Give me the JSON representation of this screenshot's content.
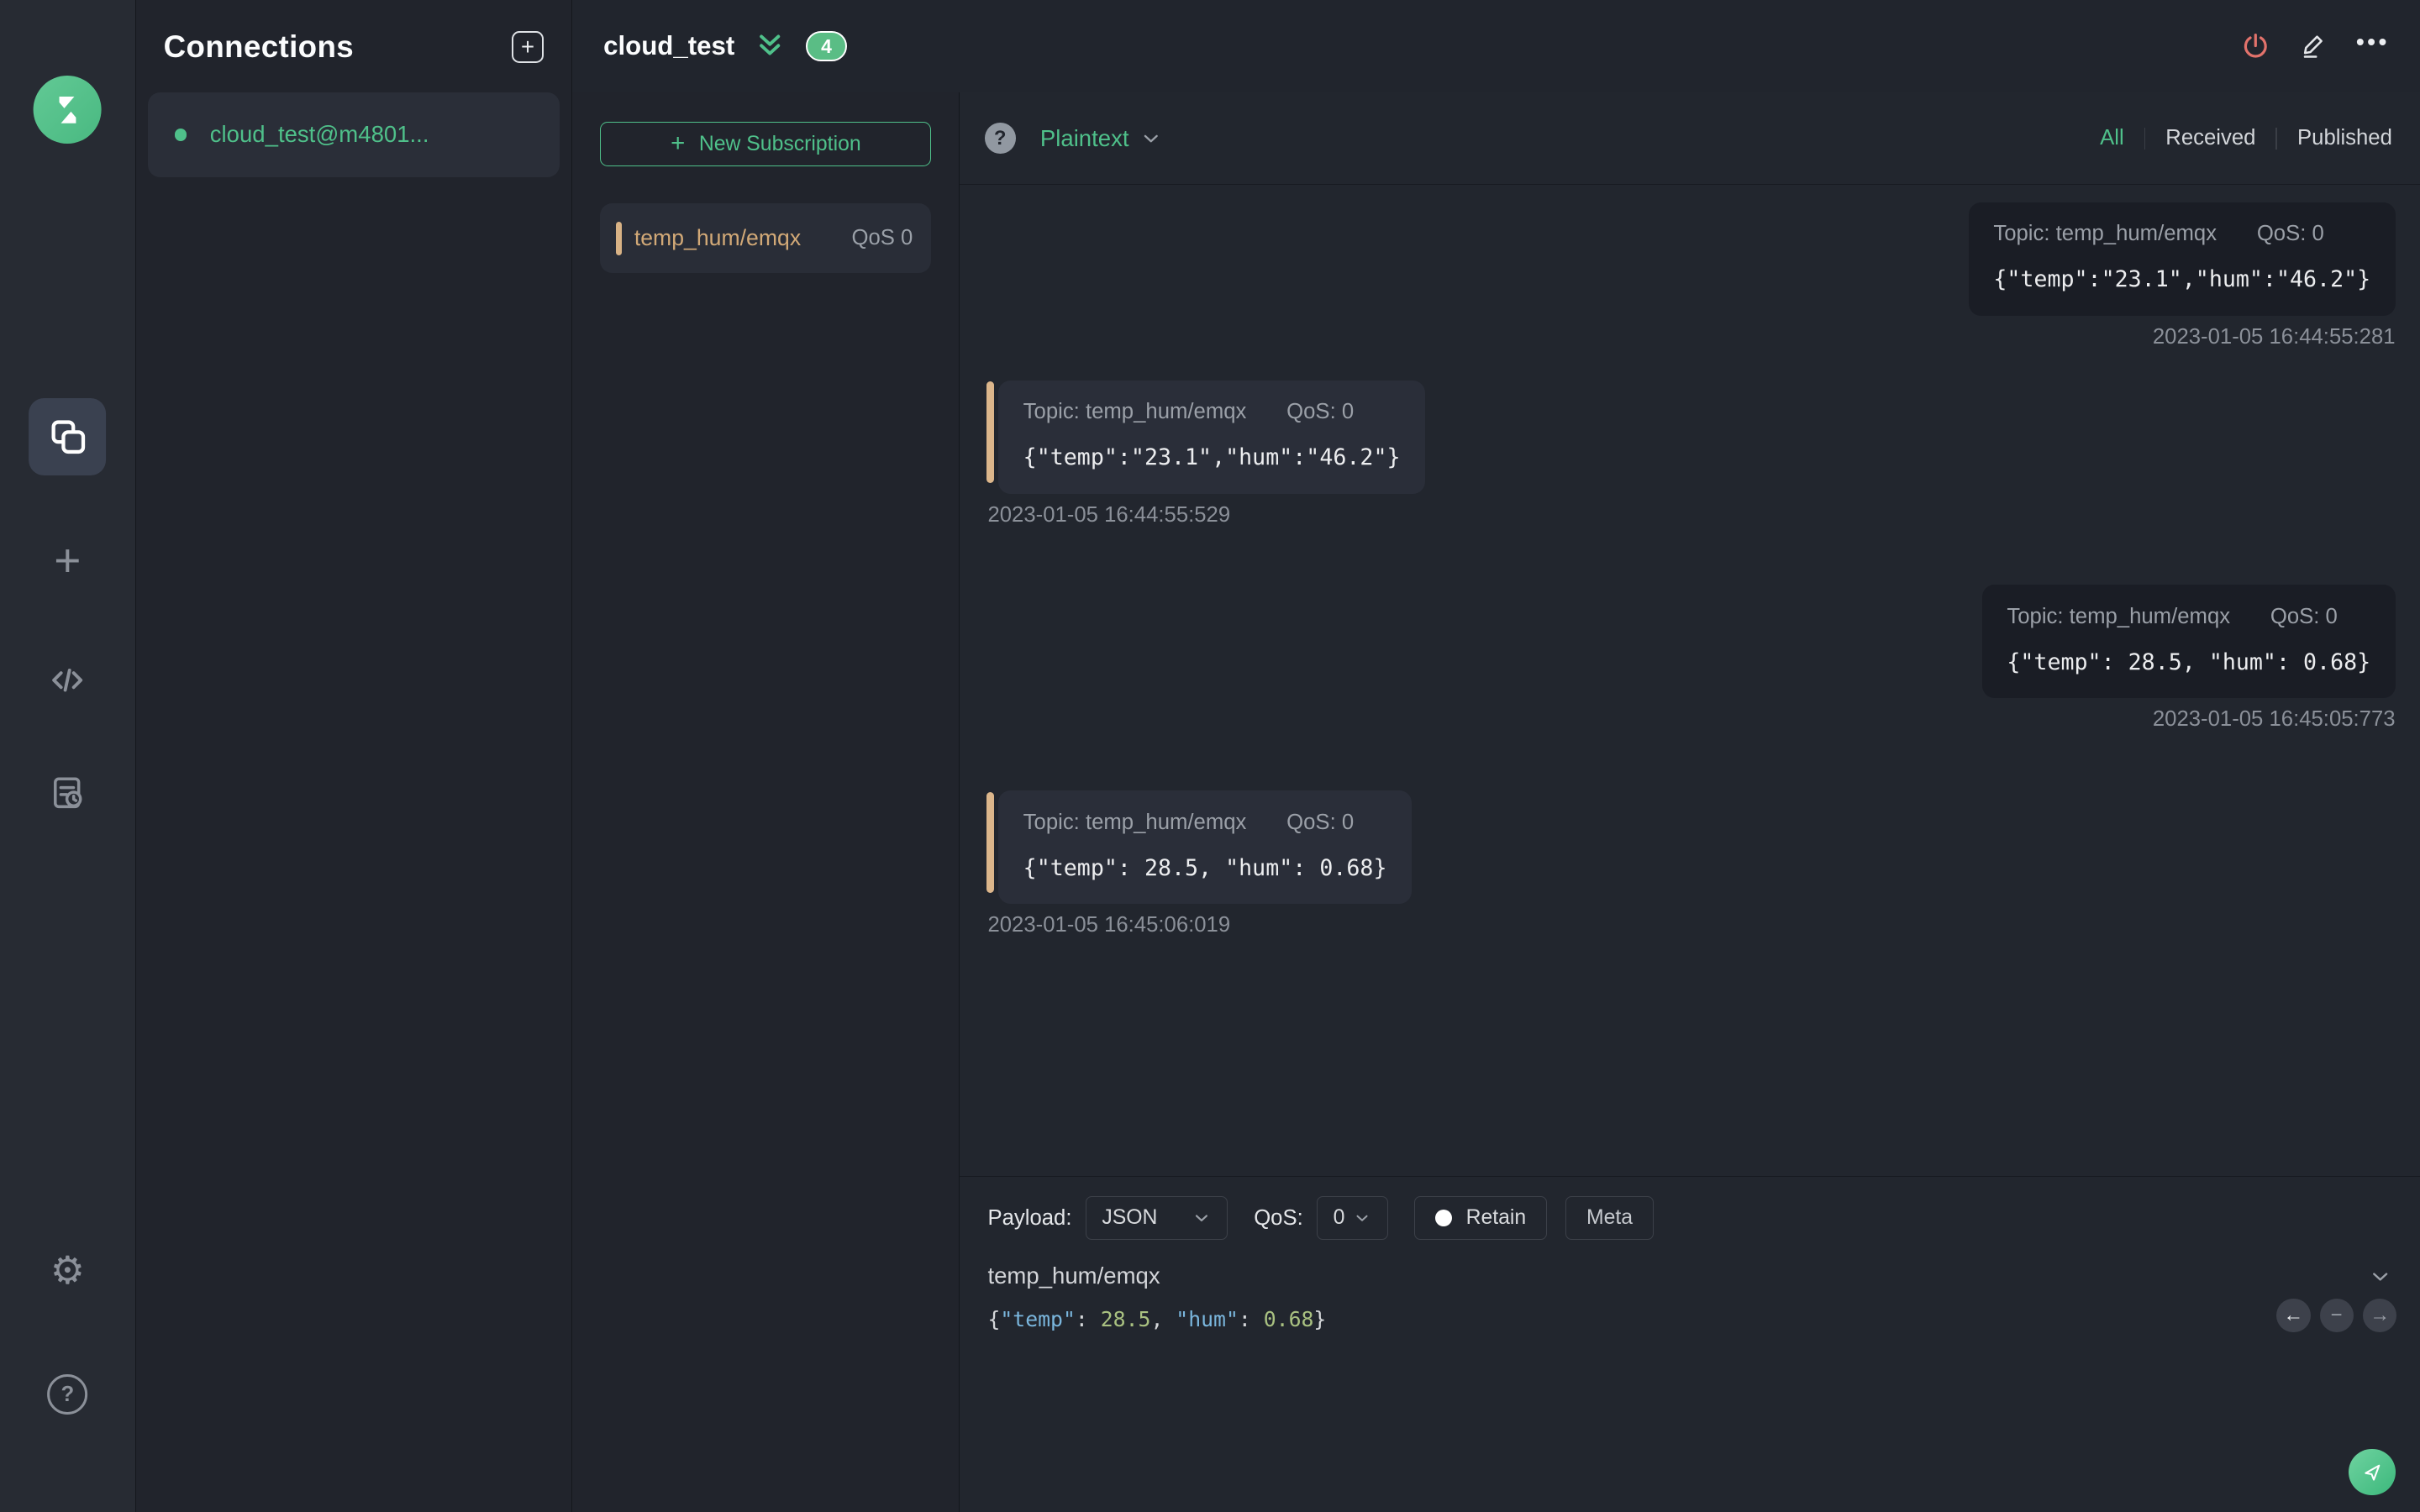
{
  "colors": {
    "accent_green": "#4fc08a",
    "badge_green": "#5abd85",
    "accent_tan": "#d8b285",
    "power_red": "#e2726b",
    "bg_dark": "#21252d"
  },
  "icons": {
    "plus": "+",
    "question": "?",
    "gear": "⚙",
    "ellipsis": "•••",
    "prev_arrow": "←",
    "minus": "−",
    "next_arrow": "→"
  },
  "connections_panel": {
    "title": "Connections",
    "items": [
      {
        "name": "cloud_test@m4801...",
        "status": "connected"
      }
    ]
  },
  "header": {
    "title": "cloud_test",
    "badge_count": "4"
  },
  "subscriptions": {
    "new_button_label": "New Subscription",
    "items": [
      {
        "topic": "temp_hum/emqx",
        "qos": "QoS 0"
      }
    ]
  },
  "messages": {
    "format_label": "Plaintext",
    "filters": [
      {
        "label": "All",
        "active": true
      },
      {
        "label": "Received",
        "active": false
      },
      {
        "label": "Published",
        "active": false
      }
    ],
    "items": [
      {
        "side": "right",
        "topic": "Topic: temp_hum/emqx",
        "qos": "QoS: 0",
        "payload": "{\"temp\":\"23.1\",\"hum\":\"46.2\"}",
        "time": "2023-01-05 16:44:55:281"
      },
      {
        "side": "left",
        "topic": "Topic: temp_hum/emqx",
        "qos": "QoS: 0",
        "payload": "{\"temp\":\"23.1\",\"hum\":\"46.2\"}",
        "time": "2023-01-05 16:44:55:529"
      },
      {
        "side": "right",
        "topic": "Topic: temp_hum/emqx",
        "qos": "QoS: 0",
        "payload": "{\"temp\": 28.5, \"hum\": 0.68}",
        "time": "2023-01-05 16:45:05:773"
      },
      {
        "side": "left",
        "topic": "Topic: temp_hum/emqx",
        "qos": "QoS: 0",
        "payload": "{\"temp\": 28.5, \"hum\": 0.68}",
        "time": "2023-01-05 16:45:06:019"
      }
    ]
  },
  "publish": {
    "payload_label": "Payload:",
    "payload_format": "JSON",
    "qos_label": "QoS:",
    "qos_value": "0",
    "retain_label": "Retain",
    "meta_label": "Meta",
    "topic_value": "temp_hum/emqx",
    "editor_tokens": [
      {
        "text": "{"
      },
      {
        "text": "\"temp\""
      },
      {
        "text": ": "
      },
      {
        "text": "28.5"
      },
      {
        "text": ", "
      },
      {
        "text": "\"hum\""
      },
      {
        "text": ": "
      },
      {
        "text": "0.68"
      },
      {
        "text": "}"
      }
    ]
  }
}
